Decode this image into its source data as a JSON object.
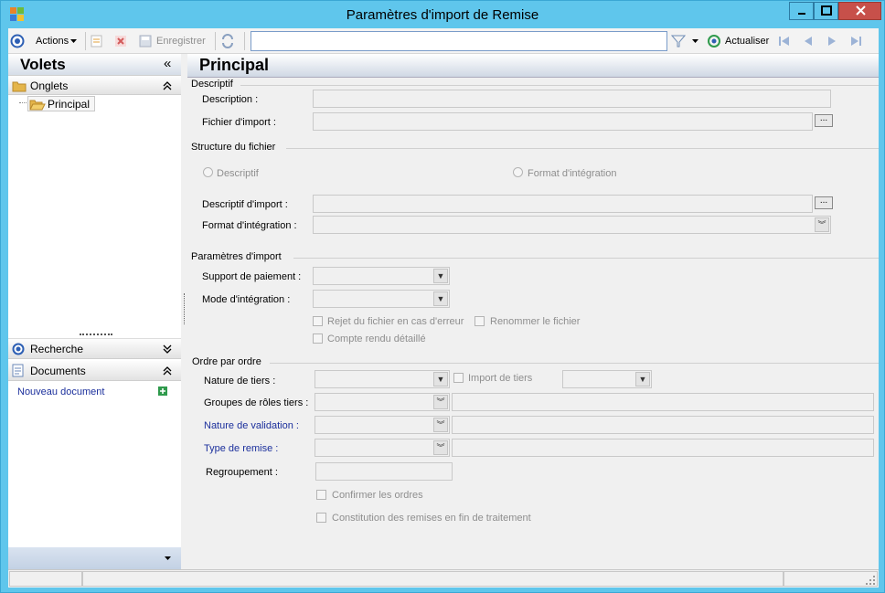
{
  "window": {
    "title": "Paramètres d'import de Remise",
    "buttons": [
      "minimize",
      "maximize",
      "close"
    ]
  },
  "toolbar": {
    "actions_label": "Actions",
    "save_label": "Enregistrer",
    "search_value": "",
    "refresh_label": "Actualiser"
  },
  "sidebar": {
    "title": "Volets",
    "collapse_glyph": "«",
    "onglets_label": "Onglets",
    "tree_item": "Principal",
    "recherche_label": "Recherche",
    "documents_label": "Documents",
    "new_document_label": "Nouveau document"
  },
  "main": {
    "title": "Principal",
    "descriptif": {
      "group": "Descriptif",
      "description_label": "Description :",
      "fichier_label": "Fichier d'import :"
    },
    "structure": {
      "group": "Structure du fichier",
      "radio_descriptif": "Descriptif",
      "radio_format": "Format d'intégration",
      "descriptif_import_label": "Descriptif d'import :",
      "format_label": "Format d'intégration :"
    },
    "parametres": {
      "group": "Paramètres d'import",
      "support_label": "Support de paiement :",
      "mode_label": "Mode d'intégration :",
      "rejet_label": "Rejet du fichier en cas d'erreur",
      "renommer_label": "Renommer le fichier",
      "compte_rendu_label": "Compte rendu détaillé"
    },
    "ordre": {
      "group": "Ordre par ordre",
      "nature_tiers_label": "Nature de tiers :",
      "import_tiers_label": "Import de tiers",
      "groupes_label": "Groupes de rôles tiers :",
      "nature_validation_label": "Nature de validation :",
      "type_remise_label": "Type de remise :",
      "regroupement_label": "Regroupement :",
      "confirmer_label": "Confirmer les ordres",
      "constitution_label": "Constitution des remises en fin de traitement"
    }
  },
  "colors": {
    "title_bar": "#5fc6ec",
    "link_blue": "#1b2f9c",
    "close_red": "#c7504a"
  }
}
